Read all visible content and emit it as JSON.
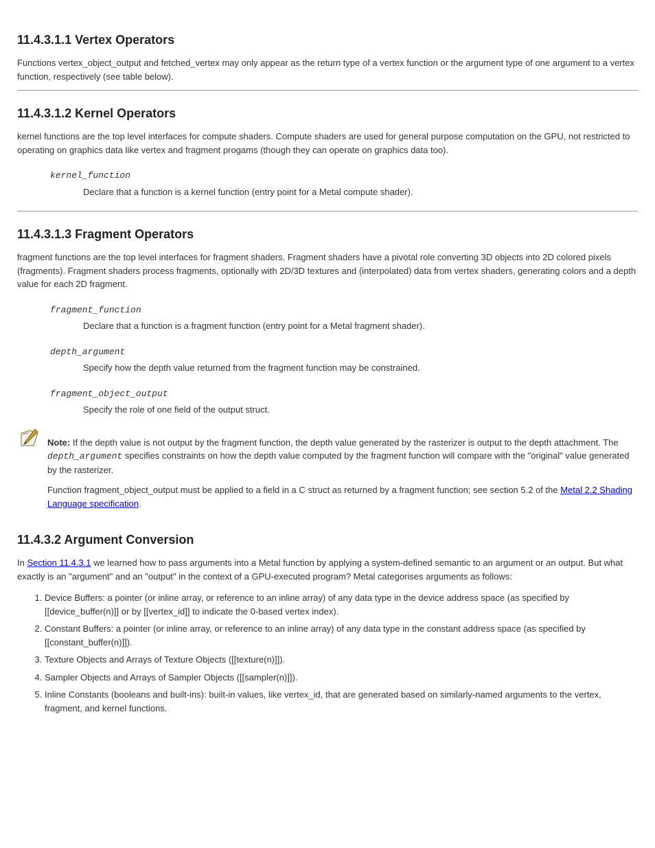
{
  "sections": [
    {
      "heading": "11.4.3.1.1 Vertex Operators",
      "paragraphs": [
        "Functions vertex_object_output and fetched_vertex may only appear as the return type of a vertex function or the argument type of one argument to a vertex function, respectively (see table below)."
      ]
    },
    {
      "heading": "11.4.3.1.2 Kernel Operators",
      "paragraphs": [
        "kernel functions are the top level interfaces for compute shaders. Compute shaders are used for general purpose computation on the GPU, not restricted to operating on graphics data like vertex and fragment progams (though they can operate on graphics data too)."
      ],
      "terms": [
        {
          "label": "kernel_function",
          "desc": "Declare that a function is a kernel function (entry point for a Metal compute shader)."
        }
      ]
    },
    {
      "heading": "11.4.3.1.3 Fragment Operators",
      "paragraphs": [
        "fragment functions are the top level interfaces for fragment shaders. Fragment shaders have a pivotal role converting 3D objects into 2D colored pixels (fragments). Fragment shaders process fragments, optionally with 2D/3D textures and (interpolated) data from vertex shaders, generating colors and a depth value for each 2D fragment."
      ],
      "terms": [
        {
          "label": "fragment_function",
          "desc": "Declare that a function is a fragment function (entry point for a Metal fragment shader)."
        },
        {
          "label": "depth_argument",
          "desc": "Specify how the depth value returned from the fragment function may be constrained."
        },
        {
          "label": "fragment_object_output",
          "desc": "Specify the role of one field of the output struct."
        }
      ]
    }
  ],
  "note": {
    "label": "Note:",
    "body_intro_prefix": "If the depth value is not output by the fragment function, the depth value generated by the rasterizer is output to the depth attachment. The ",
    "body_intro_italic": "depth_argument",
    "body_intro_suffix": " specifies constraints on how the depth value computed by the fragment function will compare with the \"original\" value generated by the rasterizer.",
    "body_middle": "Function fragment_object_output must be applied to a field in a C struct as returned by a fragment function; see section 5.2 of the ",
    "body_link": "Metal 2.2 Shading Language specification",
    "body_end": "."
  },
  "argconv": {
    "heading": "11.4.3.2 Argument Conversion",
    "intro_prefix": "In ",
    "intro_link": "Section 11.4.3.1",
    "intro_suffix": " we learned how to pass arguments into a Metal function by applying a system-defined semantic to an argument or an output. But what exactly is an \"argument\" and an \"output\" in the context of a GPU-executed program? Metal categorises arguments as follows:",
    "items": [
      "Device Buffers: a pointer (or inline array, or reference to an inline array) of any data type in the device address space (as specified by [[device_buffer(n)]] or by [[vertex_id]] to indicate the 0-based vertex index).",
      "Constant Buffers: a pointer (or inline array, or reference to an inline array) of any data type in the constant address space (as specified by [[constant_buffer(n)]]).",
      "Texture Objects and Arrays of Texture Objects ([[texture(n)]]).",
      "Sampler Objects and Arrays of Sampler Objects ([[sampler(n)]]).",
      "Inline Constants (booleans and built-ins): built-in values, like vertex_id, that are generated based on similarly-named arguments to the vertex, fragment, and kernel functions."
    ]
  }
}
